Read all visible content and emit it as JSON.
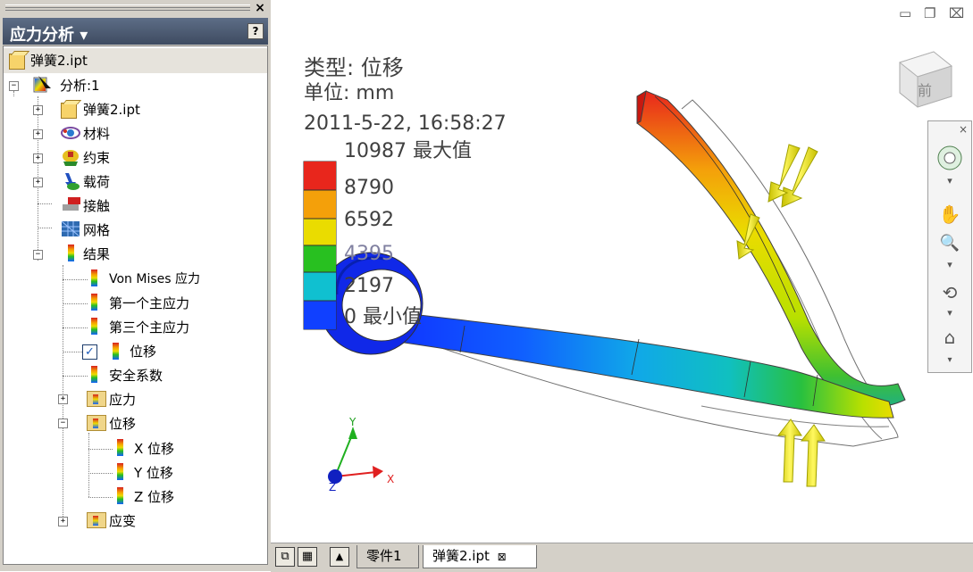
{
  "browser": {
    "title": "应力分析",
    "title_arrow": "▾",
    "help": "?",
    "close": "×",
    "tree": {
      "root": "弹簧2.ipt",
      "analysis": "分析:1",
      "part": "弹簧2.ipt",
      "material": "材料",
      "constraint": "约束",
      "load": "载荷",
      "contact": "接触",
      "mesh": "网格",
      "results": "结果",
      "von_mises": "Von Mises 应力",
      "principal1": "第一个主应力",
      "principal3": "第三个主应力",
      "displacement": "位移",
      "safety": "安全系数",
      "stress_folder": "应力",
      "disp_folder": "位移",
      "x_disp": "X 位移",
      "y_disp": "Y 位移",
      "z_disp": "Z 位移",
      "strain_folder": "应变"
    },
    "expander_plus": "+",
    "expander_minus": "−",
    "check_mark": "✓"
  },
  "viewport": {
    "legend": {
      "type_line": "类型: 位移",
      "unit_line": "单位: mm",
      "datetime": "2011-5-22, 16:58:27",
      "max_label": "10987 最大值",
      "ticks": [
        "8790",
        "6592",
        "4395",
        "2197"
      ],
      "min_label": "0 最小值",
      "colors": [
        "#e8261c",
        "#f4a00a",
        "#eadc00",
        "#28c020",
        "#10c0d0",
        "#1040ff"
      ]
    },
    "triad": {
      "x": "X",
      "y": "Y",
      "z": "Z"
    },
    "viewcube_label": "前",
    "win_controls": {
      "minimize": "▭",
      "restore": "❐",
      "close": "⌧"
    },
    "navbar": {
      "close": "×",
      "pan": "✋",
      "zoom": "🔍",
      "orbit": "⟲",
      "look": "⌂",
      "more": "▾"
    }
  },
  "tabs": {
    "items": [
      "零件1",
      "弹簧2.ipt"
    ],
    "active_close": "⊠",
    "btn_cascade": "⧉",
    "btn_tile": "▦",
    "btn_up": "▲"
  }
}
